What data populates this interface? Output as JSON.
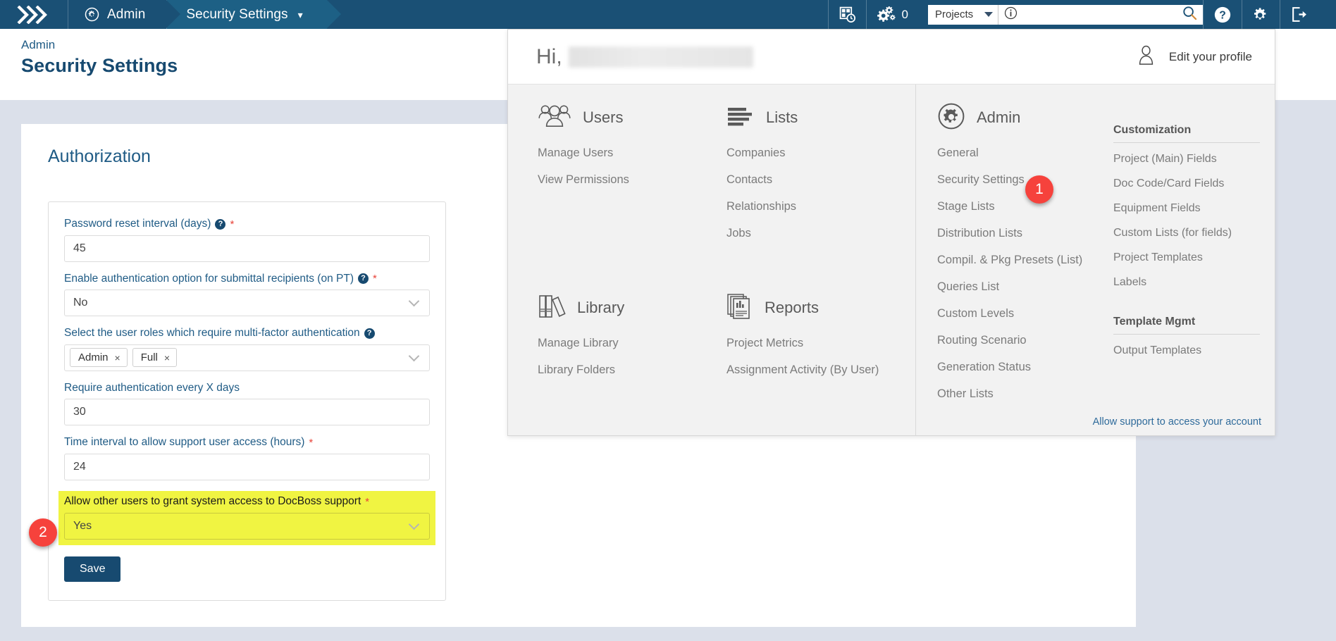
{
  "topbar": {
    "logo_icon": "double-chevron-logo",
    "tabs": [
      {
        "label": "Admin",
        "icon": "gear-circle-icon",
        "active": false
      },
      {
        "label": "Security Settings",
        "icon": "chevron-down-icon",
        "active": true
      }
    ],
    "dashboard_icon": "dashboard-clock-icon",
    "settings_gears_icon": "gears-icon",
    "settings_gears_count": "0",
    "project_select_value": "Projects",
    "project_select_caret": "caret-down-icon",
    "info_icon": "info-circle-icon",
    "search_value": "",
    "search_placeholder": "",
    "search_icon": "search-icon",
    "help_icon": "help-circle-icon",
    "gear_icon": "gear-icon",
    "logout_icon": "logout-icon"
  },
  "page": {
    "breadcrumb": "Admin",
    "title": "Security Settings"
  },
  "authorization": {
    "heading": "Authorization",
    "fields": [
      {
        "label": "Password reset interval (days)",
        "help_icon": "help-icon",
        "required": "*",
        "type": "text",
        "value": "45"
      },
      {
        "label": "Enable authentication option for submittal recipients (on PT)",
        "help_icon": "help-icon",
        "required": "*",
        "type": "select",
        "value": "No"
      },
      {
        "label": "Select the user roles which require multi-factor authentication",
        "help_icon": "help-icon",
        "required": "",
        "type": "tags",
        "tags": [
          "Admin",
          "Full"
        ],
        "tag_remove": "×"
      },
      {
        "label": "Require authentication every X days",
        "help_icon": "",
        "required": "",
        "type": "text",
        "value": "30"
      },
      {
        "label": "Time interval to allow support user access (hours)",
        "help_icon": "",
        "required": "*",
        "type": "text",
        "value": "24"
      },
      {
        "label": "Allow other users to grant system access to DocBoss support",
        "help_icon": "",
        "required": "*",
        "type": "select",
        "value": "Yes",
        "highlighted": true
      }
    ],
    "save_label": "Save"
  },
  "mega_menu": {
    "greeting": "Hi,",
    "user_name_redacted": "",
    "edit_profile_label": "Edit your profile",
    "avatar_icon": "user-avatar-icon",
    "sections": [
      {
        "title": "Users",
        "icon": "users-group-icon",
        "links": [
          "Manage Users",
          "View Permissions"
        ]
      },
      {
        "title": "Lists",
        "icon": "list-bars-icon",
        "links": [
          "Companies",
          "Contacts",
          "Relationships",
          "Jobs"
        ]
      },
      {
        "title": "Library",
        "icon": "books-icon",
        "links": [
          "Manage Library",
          "Library Folders"
        ]
      },
      {
        "title": "Reports",
        "icon": "report-pages-icon",
        "links": [
          "Project Metrics",
          "Assignment Activity (By User)"
        ]
      }
    ],
    "admin": {
      "title": "Admin",
      "icon": "gear-circle-icon",
      "links": [
        "General",
        "Security Settings",
        "Stage Lists",
        "Distribution Lists",
        "Compil. & Pkg Presets (List)",
        "Queries List",
        "Custom Levels",
        "Routing Scenario",
        "Generation Status",
        "Other Lists"
      ]
    },
    "customization": {
      "heading": "Customization",
      "links": [
        "Project (Main) Fields",
        "Doc Code/Card Fields",
        "Equipment Fields",
        "Custom Lists (for fields)",
        "Project Templates",
        "Labels"
      ]
    },
    "template_mgmt": {
      "heading": "Template Mgmt",
      "links": [
        "Output Templates"
      ]
    },
    "support_link": "Allow support to access your account"
  },
  "callouts": [
    {
      "number": "1",
      "target": "Security Settings"
    },
    {
      "number": "2",
      "target": "Allow other users to grant system access to DocBoss support"
    }
  ],
  "colors": {
    "nav_bg": "#1a5075",
    "nav_active": "#1d6085",
    "accent_blue": "#174a70",
    "link_blue": "#1f5b85",
    "page_bg": "#dbe0ea",
    "panel_bg": "#f2f2f2",
    "highlight_yellow": "#f0f442",
    "badge_red": "#f6423c",
    "required_red": "#e8443a"
  }
}
